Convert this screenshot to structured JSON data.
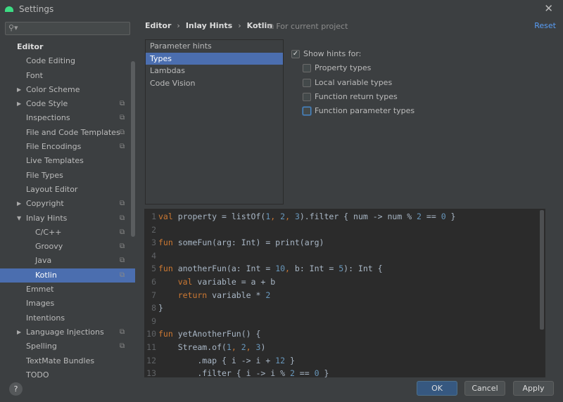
{
  "window": {
    "title": "Settings"
  },
  "search": {
    "placeholder": ""
  },
  "sidebar": {
    "items": [
      {
        "label": "Editor",
        "level": 0
      },
      {
        "label": "Code Editing",
        "level": 1
      },
      {
        "label": "Font",
        "level": 1
      },
      {
        "label": "Color Scheme",
        "level": 1,
        "arrow": "right"
      },
      {
        "label": "Code Style",
        "level": 1,
        "arrow": "right",
        "copy": true
      },
      {
        "label": "Inspections",
        "level": 1,
        "copy": true
      },
      {
        "label": "File and Code Templates",
        "level": 1,
        "copy": true
      },
      {
        "label": "File Encodings",
        "level": 1,
        "copy": true
      },
      {
        "label": "Live Templates",
        "level": 1
      },
      {
        "label": "File Types",
        "level": 1
      },
      {
        "label": "Layout Editor",
        "level": 1
      },
      {
        "label": "Copyright",
        "level": 1,
        "arrow": "right",
        "copy": true
      },
      {
        "label": "Inlay Hints",
        "level": 1,
        "arrow": "down",
        "copy": true
      },
      {
        "label": "C/C++",
        "level": 2,
        "copy": true
      },
      {
        "label": "Groovy",
        "level": 2,
        "copy": true
      },
      {
        "label": "Java",
        "level": 2,
        "copy": true
      },
      {
        "label": "Kotlin",
        "level": 2,
        "copy": true,
        "selected": true
      },
      {
        "label": "Emmet",
        "level": 1
      },
      {
        "label": "Images",
        "level": 1
      },
      {
        "label": "Intentions",
        "level": 1
      },
      {
        "label": "Language Injections",
        "level": 1,
        "arrow": "right",
        "copy": true
      },
      {
        "label": "Spelling",
        "level": 1,
        "copy": true
      },
      {
        "label": "TextMate Bundles",
        "level": 1
      },
      {
        "label": "TODO",
        "level": 1
      }
    ]
  },
  "breadcrumb": [
    "Editor",
    "Inlay Hints",
    "Kotlin"
  ],
  "scope": "For current project",
  "reset": "Reset",
  "hint_list": [
    {
      "label": "Parameter hints"
    },
    {
      "label": "Types",
      "selected": true
    },
    {
      "label": "Lambdas"
    },
    {
      "label": "Code Vision"
    }
  ],
  "options": {
    "show_hints": {
      "label": "Show hints for:",
      "checked": true
    },
    "items": [
      {
        "label": "Property types",
        "checked": false
      },
      {
        "label": "Local variable types",
        "checked": false
      },
      {
        "label": "Function return types",
        "checked": false
      },
      {
        "label": "Function parameter types",
        "checked": false,
        "focused": true
      }
    ]
  },
  "code": [
    {
      "n": "1",
      "seg": [
        [
          "val",
          "kw"
        ],
        [
          " property = listOf(",
          "txt"
        ],
        [
          "1",
          "num"
        ],
        [
          ", ",
          "kw"
        ],
        [
          "2",
          "num"
        ],
        [
          ", ",
          "kw"
        ],
        [
          "3",
          "num"
        ],
        [
          ").filter { num -> num % ",
          "txt"
        ],
        [
          "2",
          "num"
        ],
        [
          " == ",
          "txt"
        ],
        [
          "0",
          "num"
        ],
        [
          " }",
          "txt"
        ]
      ]
    },
    {
      "n": "2",
      "seg": []
    },
    {
      "n": "3",
      "seg": [
        [
          "fun",
          "kw"
        ],
        [
          " someFun(arg: Int) = print(arg)",
          "txt"
        ]
      ]
    },
    {
      "n": "4",
      "seg": []
    },
    {
      "n": "5",
      "seg": [
        [
          "fun",
          "kw"
        ],
        [
          " anotherFun(a: Int = ",
          "txt"
        ],
        [
          "10",
          "num"
        ],
        [
          ", ",
          "kw"
        ],
        [
          "b: Int = ",
          "txt"
        ],
        [
          "5",
          "num"
        ],
        [
          "): Int {",
          "txt"
        ]
      ]
    },
    {
      "n": "6",
      "seg": [
        [
          "    val",
          "kw"
        ],
        [
          " variable = a + b",
          "txt"
        ]
      ]
    },
    {
      "n": "7",
      "seg": [
        [
          "    return",
          "kw"
        ],
        [
          " variable * ",
          "txt"
        ],
        [
          "2",
          "num"
        ]
      ]
    },
    {
      "n": "8",
      "seg": [
        [
          "}",
          "txt"
        ]
      ]
    },
    {
      "n": "9",
      "seg": []
    },
    {
      "n": "10",
      "seg": [
        [
          "fun",
          "kw"
        ],
        [
          " yetAnotherFun() {",
          "txt"
        ]
      ]
    },
    {
      "n": "11",
      "seg": [
        [
          "    Stream.of(",
          "txt"
        ],
        [
          "1",
          "num"
        ],
        [
          ", ",
          "kw"
        ],
        [
          "2",
          "num"
        ],
        [
          ", ",
          "kw"
        ],
        [
          "3",
          "num"
        ],
        [
          ")",
          "txt"
        ]
      ]
    },
    {
      "n": "12",
      "seg": [
        [
          "        .map { i -> i + ",
          "txt"
        ],
        [
          "12",
          "num"
        ],
        [
          " }",
          "txt"
        ]
      ]
    },
    {
      "n": "13",
      "seg": [
        [
          "        .filter { i -> i % ",
          "txt"
        ],
        [
          "2",
          "num"
        ],
        [
          " == ",
          "txt"
        ],
        [
          "0",
          "num"
        ],
        [
          " }",
          "txt"
        ]
      ]
    }
  ],
  "footer": {
    "help": "?",
    "ok": "OK",
    "cancel": "Cancel",
    "apply": "Apply"
  }
}
